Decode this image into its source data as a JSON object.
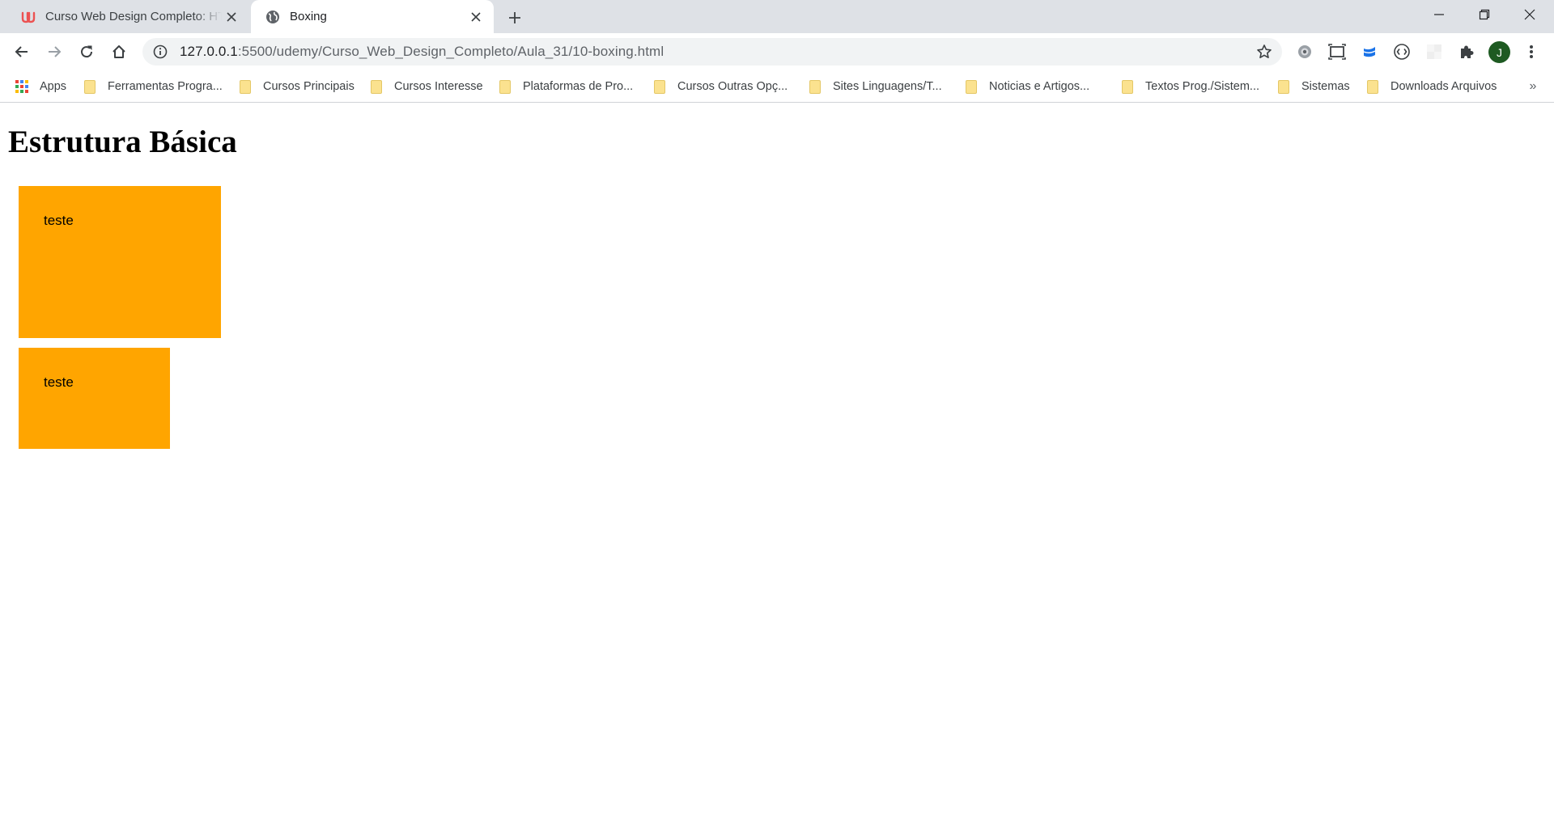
{
  "browser": {
    "tabs": [
      {
        "title": "Curso Web Design Completo: HTML",
        "active": false,
        "favicon": "udemy-logo-icon"
      },
      {
        "title": "Boxing",
        "active": true,
        "favicon": "globe-icon"
      }
    ],
    "address_bar": {
      "url_host": "127.0.0.1",
      "url_rest": ":5500/udemy/Curso_Web_Design_Completo/Aula_31/10-boxing.html"
    },
    "profile_initial": "J",
    "colors": {
      "tab_strip": "#dee1e6",
      "omnibox": "#f1f3f4",
      "avatar": "#1e5a22",
      "folder": "#fbe28f"
    }
  },
  "bookmarks": [
    {
      "label": "Apps",
      "icon": "apps-grid-icon"
    },
    {
      "label": "Ferramentas Progra...",
      "icon": "folder-icon"
    },
    {
      "label": "Cursos Principais",
      "icon": "folder-icon"
    },
    {
      "label": "Cursos Interesse",
      "icon": "folder-icon"
    },
    {
      "label": "Plataformas de Pro...",
      "icon": "folder-icon"
    },
    {
      "label": "Cursos Outras Opç...",
      "icon": "folder-icon"
    },
    {
      "label": "Sites Linguagens/T...",
      "icon": "folder-icon"
    },
    {
      "label": "Noticias e Artigos...",
      "icon": "folder-icon"
    },
    {
      "label": "Textos Prog./Sistem...",
      "icon": "folder-icon"
    },
    {
      "label": "Sistemas",
      "icon": "folder-icon"
    },
    {
      "label": "Downloads Arquivos",
      "icon": "folder-icon"
    }
  ],
  "page": {
    "heading": "Estrutura Básica",
    "boxes": [
      {
        "text": "teste"
      },
      {
        "text": "teste"
      }
    ],
    "box_color": "#ffa500"
  }
}
